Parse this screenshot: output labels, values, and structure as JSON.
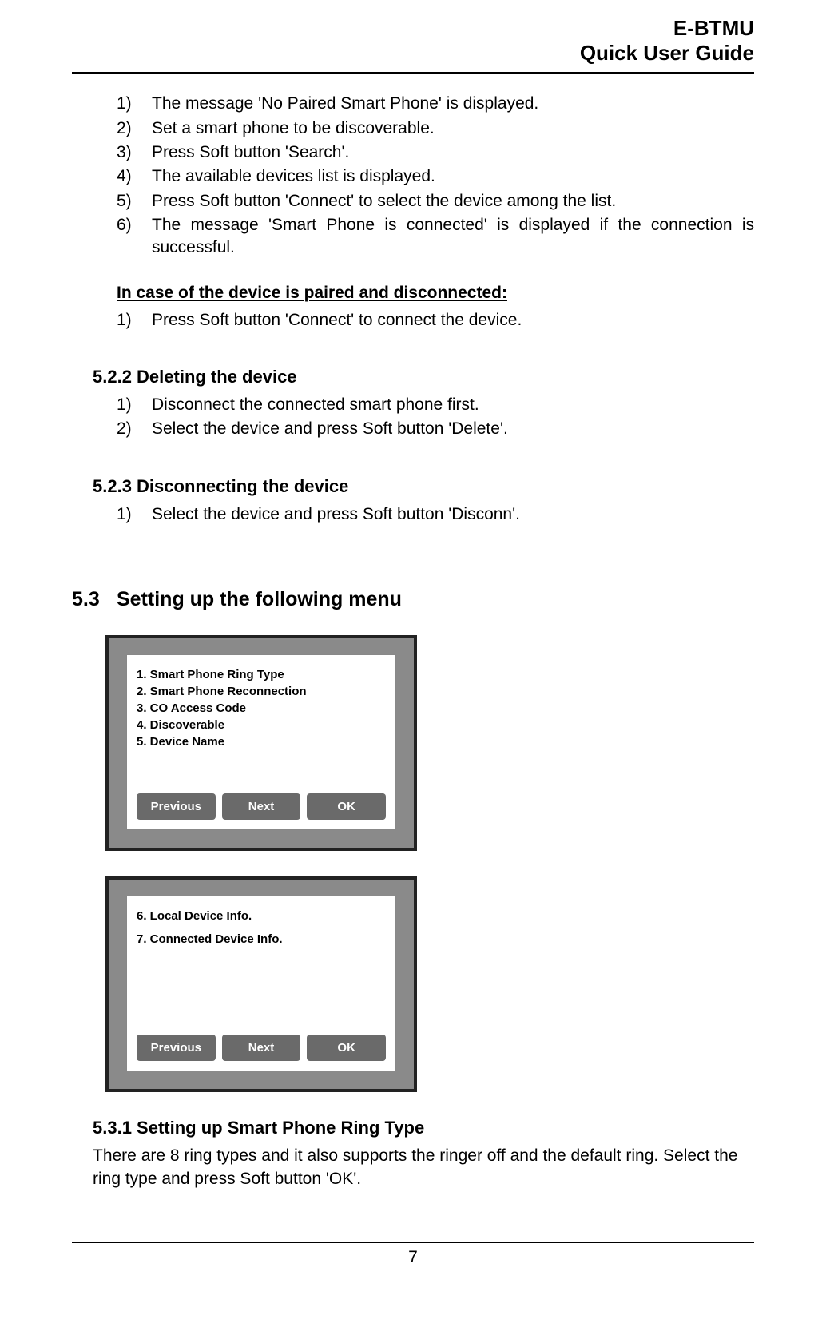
{
  "header": {
    "line1": "E-BTMU",
    "line2": "Quick User Guide"
  },
  "list1": [
    {
      "num": "1)",
      "text": "The message 'No Paired Smart Phone' is displayed."
    },
    {
      "num": "2)",
      "text": "Set a smart phone to be discoverable."
    },
    {
      "num": "3)",
      "text": "Press Soft button 'Search'."
    },
    {
      "num": "4)",
      "text": "The available devices list is displayed."
    },
    {
      "num": "5)",
      "text": "Press Soft button 'Connect' to select the device among the list."
    },
    {
      "num": "6)",
      "text": "The message 'Smart Phone is connected' is displayed if the connection is successful."
    }
  ],
  "subhead1": "In case of the device is paired and disconnected:",
  "list2": [
    {
      "num": "1)",
      "text": "Press Soft button 'Connect' to connect the device."
    }
  ],
  "h3a": "5.2.2 Deleting the device",
  "list3": [
    {
      "num": "1)",
      "text": "Disconnect the connected smart phone first."
    },
    {
      "num": "2)",
      "text": "Select the device and press Soft button 'Delete'."
    }
  ],
  "h3b": "5.2.3 Disconnecting the device",
  "list4": [
    {
      "num": "1)",
      "text": "Select the device and press Soft button 'Disconn'."
    }
  ],
  "h2": {
    "num": "5.3",
    "title": "Setting up the following menu"
  },
  "screen1": {
    "items": [
      "1. Smart Phone Ring Type",
      "2. Smart Phone Reconnection",
      "3. CO Access Code",
      "4. Discoverable",
      "5. Device Name"
    ],
    "buttons": {
      "prev": "Previous",
      "next": "Next",
      "ok": "OK"
    }
  },
  "screen2": {
    "items": [
      "6. Local Device Info.",
      "7. Connected Device Info."
    ],
    "buttons": {
      "prev": "Previous",
      "next": "Next",
      "ok": "OK"
    }
  },
  "h3c": "5.3.1 Setting up Smart Phone Ring Type",
  "para1": "There are 8 ring types and it also supports the ringer off and the default ring. Select the ring type and press Soft button 'OK'.",
  "page_number": "7"
}
